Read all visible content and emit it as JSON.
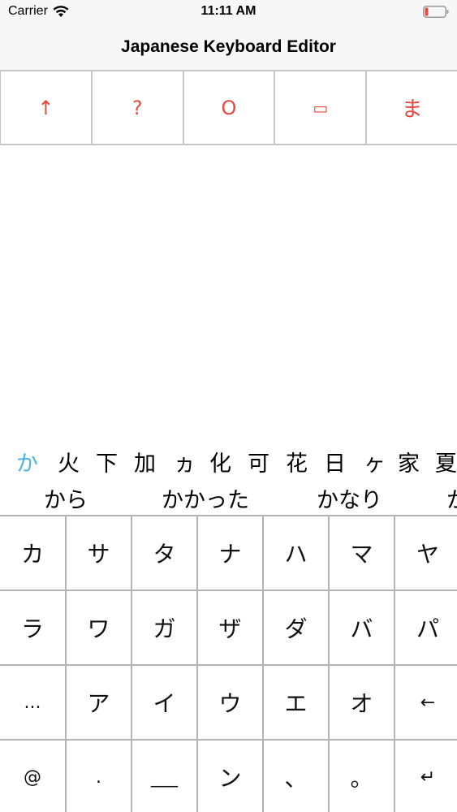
{
  "status_bar": {
    "carrier": "Carrier",
    "time": "11:11 AM"
  },
  "nav": {
    "title": "Japanese Keyboard Editor"
  },
  "toolbar": {
    "buttons": [
      {
        "label": "↑"
      },
      {
        "label": "?"
      },
      {
        "label": "O"
      },
      {
        "label": "▭"
      },
      {
        "label": "ま"
      }
    ]
  },
  "candidates": [
    "か",
    "火",
    "下",
    "加",
    "ヵ",
    "化",
    "可",
    "花",
    "日",
    "ヶ",
    "家",
    "夏"
  ],
  "suggestions": [
    "から",
    "かかった",
    "かなり",
    "か"
  ],
  "keyboard": {
    "rows": [
      [
        "カ",
        "サ",
        "タ",
        "ナ",
        "ハ",
        "マ",
        "ヤ"
      ],
      [
        "ラ",
        "ワ",
        "ガ",
        "ザ",
        "ダ",
        "バ",
        "パ"
      ],
      [
        "...",
        "ア",
        "イ",
        "ウ",
        "エ",
        "オ",
        "←"
      ],
      [
        "@",
        ".",
        "___",
        "ン",
        "、",
        "。",
        "↵"
      ]
    ]
  },
  "colors": {
    "accent": "#e8473b",
    "active_candidate": "#4ab6e8",
    "bar_bg": "#f7f7f7",
    "grid": "#b3b3b3"
  }
}
